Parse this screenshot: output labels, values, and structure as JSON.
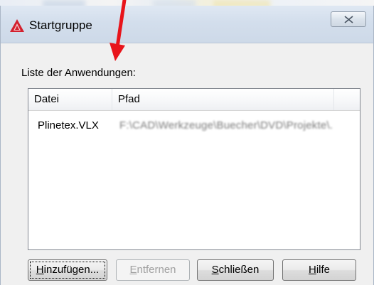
{
  "window": {
    "title": "Startgruppe",
    "close_symbol": "✕"
  },
  "list": {
    "label": "Liste der Anwendungen:",
    "columns": [
      "Datei",
      "Pfad"
    ],
    "rows": [
      {
        "file": "Plinetex.VLX",
        "path": "F:\\CAD\\Werkzeuge\\Buecher\\DVD\\Projekte\\..."
      }
    ]
  },
  "buttons": {
    "add": {
      "mnemonic": "H",
      "rest": "inzufügen..."
    },
    "remove": {
      "mnemonic": "E",
      "rest": "ntfernen",
      "enabled": false
    },
    "close": {
      "mnemonic": "S",
      "rest": "chließen"
    },
    "help": {
      "mnemonic": "H",
      "rest": "ilfe"
    }
  },
  "colors": {
    "annotation_arrow": "#e8141b",
    "app_icon": "#d3202e"
  },
  "icons": [
    "autocad-logo-icon",
    "close-icon",
    "annotation-arrow-icon"
  ]
}
